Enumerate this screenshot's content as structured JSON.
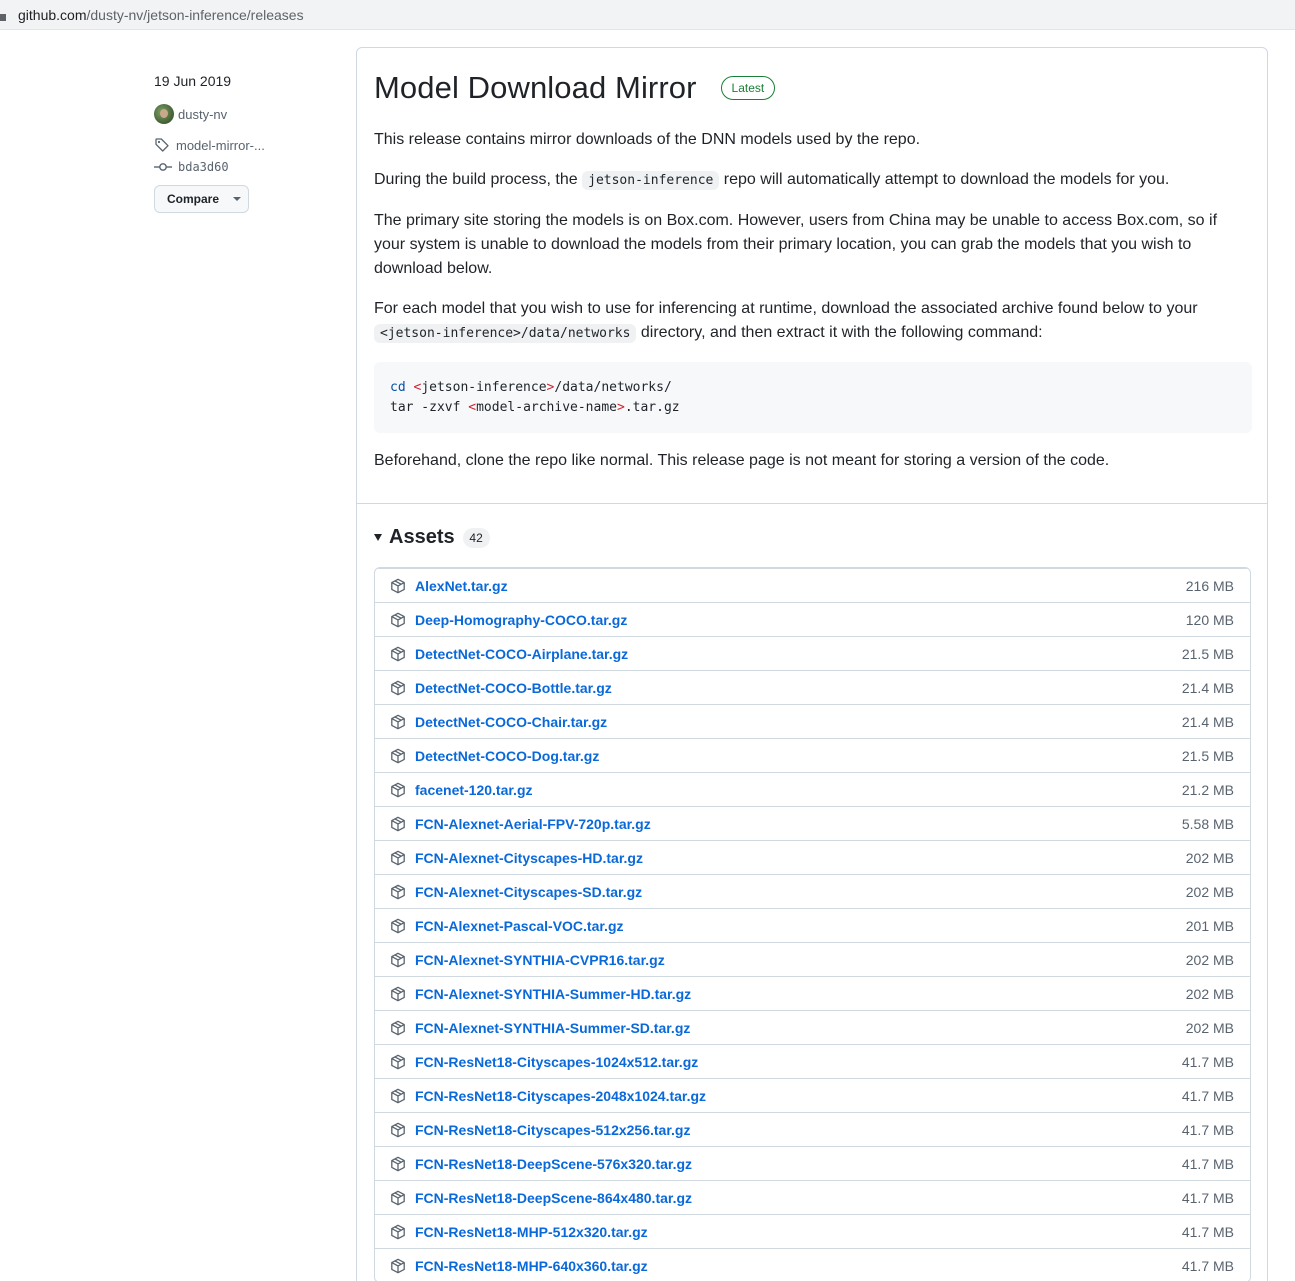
{
  "browser": {
    "url_host": "github.com",
    "url_path": "/dusty-nv/jetson-inference/releases"
  },
  "sidebar": {
    "date": "19 Jun 2019",
    "author": "dusty-nv",
    "tag": "model-mirror-...",
    "commit": "bda3d60",
    "compare_label": "Compare"
  },
  "release": {
    "title": "Model Download Mirror",
    "badge": "Latest",
    "p1": "This release contains mirror downloads of the DNN models used by the repo.",
    "p2_pre": "During the build process, the ",
    "p2_code": "jetson-inference",
    "p2_post": " repo will automatically attempt to download the models for you.",
    "p3": "The primary site storing the models is on Box.com. However, users from China may be unable to access Box.com, so if your system is unable to download the models from their primary location, you can grab the models that you wish to download below.",
    "p4_pre": "For each model that you wish to use for inferencing at runtime, download the associated archive found below to your ",
    "p4_code": "<jetson-inference>/data/networks",
    "p4_post": " directory, and then extract it with the following command:",
    "code_l1_kw": "cd",
    "code_l1_lt": "<",
    "code_l1_mid": "jetson-inference",
    "code_l1_gt": ">",
    "code_l1_rest": "/data/networks/",
    "code_l2_pre": "tar -zxvf ",
    "code_l2_lt": "<",
    "code_l2_mid": "model-archive-name",
    "code_l2_gt": ">",
    "code_l2_rest": ".tar.gz",
    "p5": "Beforehand, clone the repo like normal. This release page is not meant for storing a version of the code."
  },
  "assets": {
    "label": "Assets",
    "count": "42",
    "items": [
      {
        "name": "AlexNet.tar.gz",
        "size": "216 MB"
      },
      {
        "name": "Deep-Homography-COCO.tar.gz",
        "size": "120 MB"
      },
      {
        "name": "DetectNet-COCO-Airplane.tar.gz",
        "size": "21.5 MB"
      },
      {
        "name": "DetectNet-COCO-Bottle.tar.gz",
        "size": "21.4 MB"
      },
      {
        "name": "DetectNet-COCO-Chair.tar.gz",
        "size": "21.4 MB"
      },
      {
        "name": "DetectNet-COCO-Dog.tar.gz",
        "size": "21.5 MB"
      },
      {
        "name": "facenet-120.tar.gz",
        "size": "21.2 MB"
      },
      {
        "name": "FCN-Alexnet-Aerial-FPV-720p.tar.gz",
        "size": "5.58 MB"
      },
      {
        "name": "FCN-Alexnet-Cityscapes-HD.tar.gz",
        "size": "202 MB"
      },
      {
        "name": "FCN-Alexnet-Cityscapes-SD.tar.gz",
        "size": "202 MB"
      },
      {
        "name": "FCN-Alexnet-Pascal-VOC.tar.gz",
        "size": "201 MB"
      },
      {
        "name": "FCN-Alexnet-SYNTHIA-CVPR16.tar.gz",
        "size": "202 MB"
      },
      {
        "name": "FCN-Alexnet-SYNTHIA-Summer-HD.tar.gz",
        "size": "202 MB"
      },
      {
        "name": "FCN-Alexnet-SYNTHIA-Summer-SD.tar.gz",
        "size": "202 MB"
      },
      {
        "name": "FCN-ResNet18-Cityscapes-1024x512.tar.gz",
        "size": "41.7 MB"
      },
      {
        "name": "FCN-ResNet18-Cityscapes-2048x1024.tar.gz",
        "size": "41.7 MB"
      },
      {
        "name": "FCN-ResNet18-Cityscapes-512x256.tar.gz",
        "size": "41.7 MB"
      },
      {
        "name": "FCN-ResNet18-DeepScene-576x320.tar.gz",
        "size": "41.7 MB"
      },
      {
        "name": "FCN-ResNet18-DeepScene-864x480.tar.gz",
        "size": "41.7 MB"
      },
      {
        "name": "FCN-ResNet18-MHP-512x320.tar.gz",
        "size": "41.7 MB"
      },
      {
        "name": "FCN-ResNet18-MHP-640x360.tar.gz",
        "size": "41.7 MB"
      }
    ]
  }
}
